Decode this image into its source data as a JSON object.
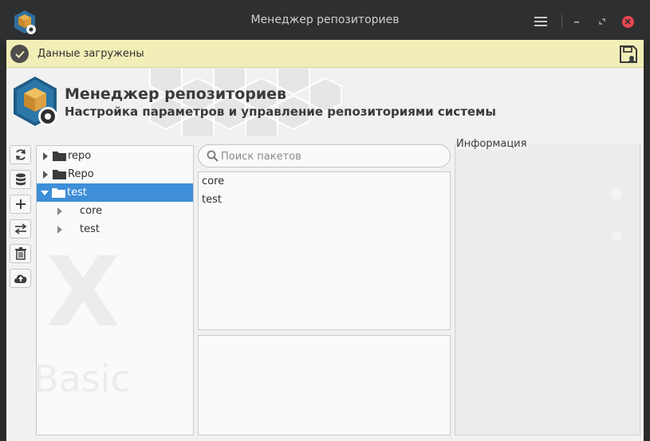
{
  "window": {
    "title": "Менеджер репозиториев",
    "icons": {
      "app": "app-logo-icon",
      "menu": "hamburger-menu-icon",
      "minimize": "minimize-icon",
      "maximize": "maximize-icon",
      "close": "close-icon"
    }
  },
  "notification": {
    "message": "Данные загружены",
    "status_icon": "checkmark-icon",
    "action_icon": "save-icon",
    "background": "#f1efb7"
  },
  "header": {
    "title": "Менеджер репозиториев",
    "subtitle": "Настройка параметров и управление репозиториями системы"
  },
  "toolbar": {
    "buttons": [
      {
        "icon": "refresh-icon"
      },
      {
        "icon": "database-icon"
      },
      {
        "icon": "add-icon"
      },
      {
        "icon": "swap-icon"
      },
      {
        "icon": "trash-icon"
      },
      {
        "icon": "cloud-upload-icon"
      }
    ]
  },
  "tree": {
    "watermark": [
      "X",
      "Basic"
    ],
    "items": [
      {
        "label": "repo",
        "expanded": false,
        "selected": false,
        "level": 0
      },
      {
        "label": "Repo",
        "expanded": false,
        "selected": false,
        "level": 0
      },
      {
        "label": "test",
        "expanded": true,
        "selected": true,
        "level": 0
      },
      {
        "label": "core",
        "expanded": false,
        "selected": false,
        "level": 1
      },
      {
        "label": "test",
        "expanded": false,
        "selected": false,
        "level": 1
      }
    ]
  },
  "search": {
    "placeholder": "Поиск пакетов",
    "value": ""
  },
  "packages": {
    "items": [
      "core",
      "test"
    ]
  },
  "info": {
    "label": "Информация"
  },
  "colors": {
    "selection": "#3e8ed8",
    "close": "#e8484f",
    "titlebar": "#2e2f30"
  }
}
